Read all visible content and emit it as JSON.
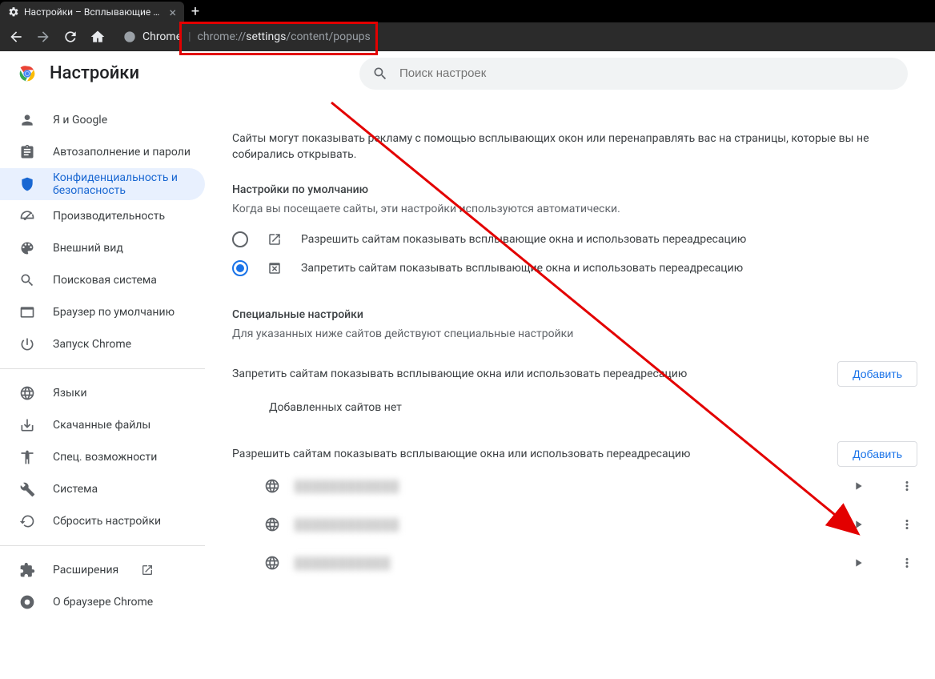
{
  "tab": {
    "title": "Настройки – Всплывающие окна"
  },
  "omnibox": {
    "chip": "Chrome",
    "url_pre": "chrome://",
    "url_bold": "settings",
    "url_post": "/content/popups"
  },
  "app": {
    "title": "Настройки"
  },
  "search": {
    "placeholder": "Поиск настроек"
  },
  "sidebar": {
    "items": [
      {
        "label": "Я и Google",
        "icon": "person"
      },
      {
        "label": "Автозаполнение и пароли",
        "icon": "assignment"
      },
      {
        "label": "Конфиденциальность и безопасность",
        "icon": "shield",
        "active": true
      },
      {
        "label": "Производительность",
        "icon": "speed"
      },
      {
        "label": "Внешний вид",
        "icon": "palette"
      },
      {
        "label": "Поисковая система",
        "icon": "search"
      },
      {
        "label": "Браузер по умолчанию",
        "icon": "window"
      },
      {
        "label": "Запуск Chrome",
        "icon": "power"
      }
    ],
    "extra": [
      {
        "label": "Языки",
        "icon": "globe"
      },
      {
        "label": "Скачанные файлы",
        "icon": "download"
      },
      {
        "label": "Спец. возможности",
        "icon": "accessibility"
      },
      {
        "label": "Система",
        "icon": "wrench"
      },
      {
        "label": "Сбросить настройки",
        "icon": "reset"
      }
    ],
    "footer": [
      {
        "label": "Расширения",
        "icon": "extension",
        "ext": true
      },
      {
        "label": "О браузере Chrome",
        "icon": "chrome"
      }
    ]
  },
  "page": {
    "intro": "Сайты могут показывать рекламу с помощью всплывающих окон или перенаправлять вас на страницы, которые вы не собирались открывать.",
    "defaults_h": "Настройки по умолчанию",
    "defaults_sub": "Когда вы посещаете сайты, эти настройки используются автоматически.",
    "opt_allow": "Разрешить сайтам показывать всплывающие окна и использовать переадресацию",
    "opt_block": "Запретить сайтам показывать всплывающие окна и использовать переадресацию",
    "custom_h": "Специальные настройки",
    "custom_sub": "Для указанных ниже сайтов действуют специальные настройки",
    "block_list_h": "Запретить сайтам показывать всплывающие окна или использовать переадресацию",
    "allow_list_h": "Разрешить сайтам показывать всплывающие окна или использовать переадресацию",
    "add": "Добавить",
    "empty": "Добавленных сайтов нет",
    "sites": [
      "████████████",
      "████████████",
      "███████████"
    ]
  }
}
